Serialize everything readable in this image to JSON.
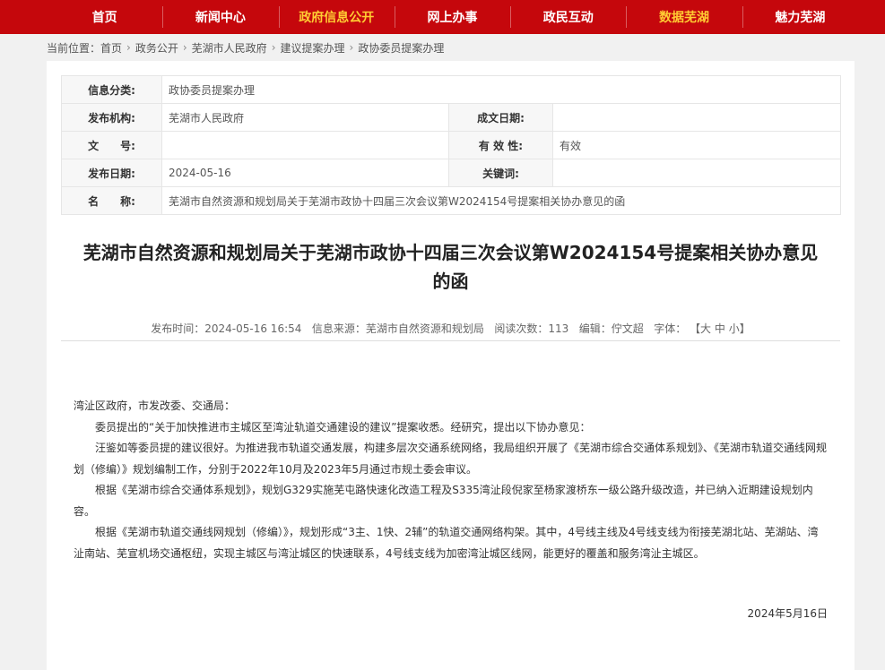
{
  "nav": [
    {
      "label": "首页",
      "highlight": false
    },
    {
      "label": "新闻中心",
      "highlight": false
    },
    {
      "label": "政府信息公开",
      "highlight": true
    },
    {
      "label": "网上办事",
      "highlight": false
    },
    {
      "label": "政民互动",
      "highlight": false
    },
    {
      "label": "数据芜湖",
      "highlight": true
    },
    {
      "label": "魅力芜湖",
      "highlight": false
    }
  ],
  "breadcrumb": {
    "prefix": "当前位置：",
    "items": [
      "首页",
      "政务公开",
      "芜湖市人民政府",
      "建议提案办理",
      "政协委员提案办理"
    ],
    "sep": "›"
  },
  "meta": {
    "category_label": "信息分类:",
    "category_value": "政协委员提案办理",
    "publisher_label": "发布机构:",
    "publisher_value": "芜湖市人民政府",
    "created_label": "成文日期:",
    "created_value": "",
    "docno_label": "文　　号:",
    "docno_value": "",
    "validity_label": "有 效 性:",
    "validity_value": "有效",
    "pubdate_label": "发布日期:",
    "pubdate_value": "2024-05-16",
    "keywords_label": "关键词:",
    "keywords_value": "",
    "name_label": "名　　称:",
    "name_value": "芜湖市自然资源和规划局关于芜湖市政协十四届三次会议第W2024154号提案相关协办意见的函"
  },
  "article": {
    "title": "芜湖市自然资源和规划局关于芜湖市政协十四届三次会议第W2024154号提案相关协办意见的函",
    "info": {
      "time_label": "发布时间：",
      "time": "2024-05-16 16:54",
      "source_label": "信息来源：",
      "source": "芜湖市自然资源和规划局",
      "views_label": "阅读次数：",
      "views": "113",
      "editor_label": "编辑：",
      "editor": "佇文超",
      "font_label": "字体：",
      "font_open": "【",
      "font_large": "大",
      "font_medium": "中",
      "font_small": "小",
      "font_close": "】"
    },
    "paragraphs": [
      "湾沚区政府，市发改委、交通局：",
      "委员提出的“关于加快推进市主城区至湾沚轨道交通建设的建议”提案收悉。经研究，提出以下协办意见：",
      "汪鉴如等委员提的建议很好。为推进我市轨道交通发展，构建多层次交通系统网络，我局组织开展了《芜湖市综合交通体系规划》、《芜湖市轨道交通线网规划（修编）》规划编制工作，分别于2022年10月及2023年5月通过市规土委会审议。",
      "根据《芜湖市综合交通体系规划》，规划G329实施芜屯路快速化改造工程及S335湾沚段倪家至杨家渡桥东一级公路升级改造，并已纳入近期建设规划内容。",
      "根据《芜湖市轨道交通线网规划（修编）》，规划形成“3主、1快、2辅”的轨道交通网络构架。其中，4号线主线及4号线支线为衔接芜湖北站、芜湖站、湾沚南站、芜宣机场交通枢纽，实现主城区与湾沚城区的快速联系，4号线支线为加密湾沚城区线网，能更好的覆盖和服务湾沚主城区。"
    ],
    "date": "2024年5月16日"
  },
  "colors": {
    "nav_bg": "#c5070c",
    "nav_highlight": "#ffcc33"
  }
}
